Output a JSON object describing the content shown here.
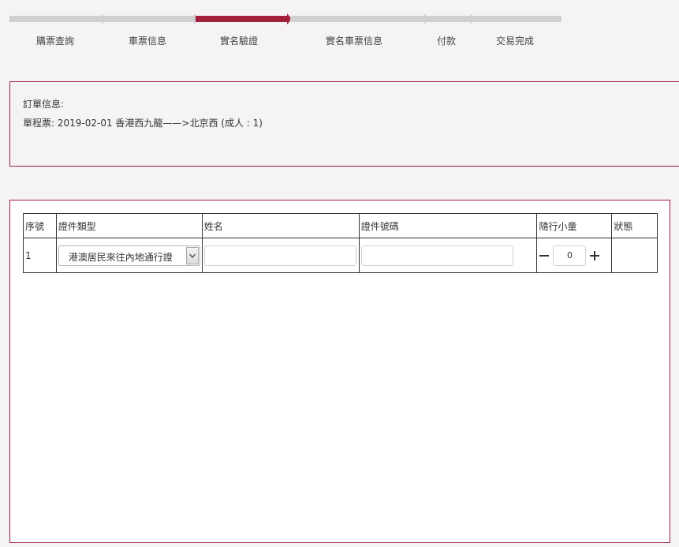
{
  "steps": [
    {
      "label": "購票查詢",
      "state": "done"
    },
    {
      "label": "車票信息",
      "state": "done"
    },
    {
      "label": "實名驗證",
      "state": "active"
    },
    {
      "label": "實名車票信息",
      "state": "pending"
    },
    {
      "label": "付款",
      "state": "pending"
    },
    {
      "label": "交易完成",
      "state": "pending"
    }
  ],
  "colors": {
    "accent": "#a31f3c",
    "track": "#d0d0d0",
    "border": "#333333",
    "background": "#f5f3f6"
  },
  "order": {
    "title": "訂單信息:",
    "detail": "單程票: 2019-02-01 香港西九龍——>北京西 (成人 : 1)"
  },
  "passenger_table": {
    "headers": [
      "序號",
      "證件類型",
      "姓名",
      "證件號碼",
      "隨行小童",
      "狀態"
    ],
    "rows": [
      {
        "index": "1",
        "id_type": "港澳居民來往內地通行證",
        "name": "",
        "id_number": "",
        "child_count": "0",
        "status": ""
      }
    ]
  },
  "icons": {
    "select_arrow": "chevron-down-icon",
    "decrement": "minus-icon",
    "increment": "plus-icon"
  }
}
